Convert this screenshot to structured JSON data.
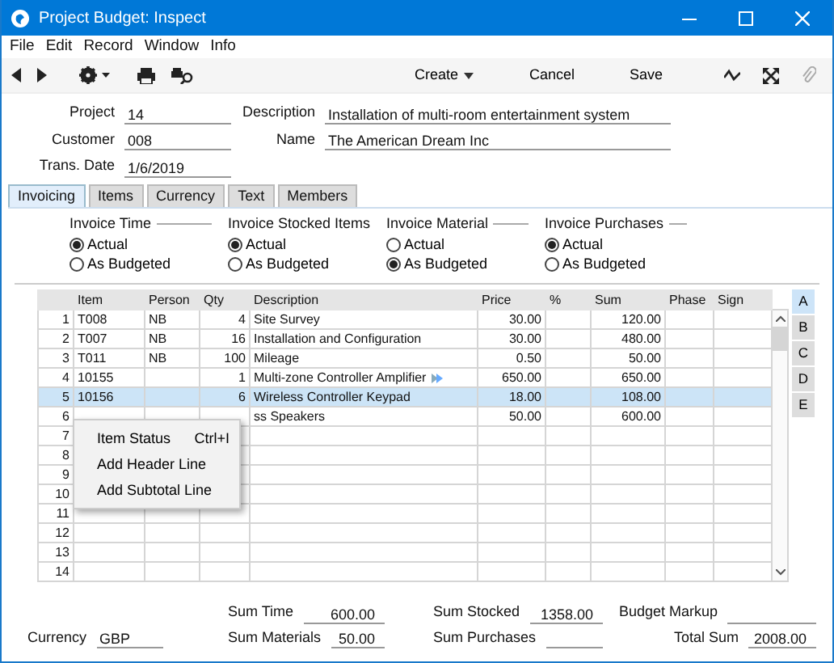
{
  "window": {
    "title": "Project Budget: Inspect"
  },
  "menu": [
    "File",
    "Edit",
    "Record",
    "Window",
    "Info"
  ],
  "toolbar": {
    "buttons": [
      {
        "label": "Create",
        "kind": "dropdown"
      },
      {
        "label": "Cancel",
        "kind": "plain"
      },
      {
        "label": "Save",
        "kind": "plain"
      }
    ]
  },
  "header_left": [
    {
      "label": "Project",
      "value": "14"
    },
    {
      "label": "Customer",
      "value": "008"
    },
    {
      "label": "Trans. Date",
      "value": "1/6/2019"
    }
  ],
  "header_right": [
    {
      "label": "Description",
      "value": "Installation of multi-room entertainment system"
    },
    {
      "label": "Name",
      "value": "The American Dream Inc"
    }
  ],
  "tabs": [
    {
      "label": "Invoicing",
      "selected": true
    },
    {
      "label": "Items",
      "selected": false
    },
    {
      "label": "Currency",
      "selected": false
    },
    {
      "label": "Text",
      "selected": false
    },
    {
      "label": "Members",
      "selected": false
    }
  ],
  "radio_groups": [
    {
      "title": "Invoice Time",
      "options": [
        {
          "label": "Actual",
          "selected": true
        },
        {
          "label": "As Budgeted",
          "selected": false
        }
      ]
    },
    {
      "title": "Invoice Stocked Items",
      "options": [
        {
          "label": "Actual",
          "selected": true
        },
        {
          "label": "As Budgeted",
          "selected": false
        }
      ]
    },
    {
      "title": "Invoice Material",
      "options": [
        {
          "label": "Actual",
          "selected": false
        },
        {
          "label": "As Budgeted",
          "selected": true
        }
      ]
    },
    {
      "title": "Invoice Purchases",
      "options": [
        {
          "label": "Actual",
          "selected": true
        },
        {
          "label": "As Budgeted",
          "selected": false
        }
      ]
    }
  ],
  "table": {
    "columns": [
      "Item",
      "Person",
      "Qty",
      "Description",
      "Price",
      "%",
      "Sum",
      "Phase",
      "Sign"
    ],
    "rows": [
      {
        "number": "1",
        "selected": false,
        "cells": [
          "T008",
          "NB",
          "4",
          "Site Survey",
          "30.00",
          "",
          "120.00",
          "",
          ""
        ]
      },
      {
        "number": "2",
        "selected": false,
        "cells": [
          "T007",
          "NB",
          "16",
          "Installation and Configuration",
          "30.00",
          "",
          "480.00",
          "",
          ""
        ]
      },
      {
        "number": "3",
        "selected": false,
        "cells": [
          "T011",
          "NB",
          "100",
          "Mileage",
          "0.50",
          "",
          "50.00",
          "",
          ""
        ]
      },
      {
        "number": "4",
        "selected": false,
        "linked": true,
        "cells": [
          "10155",
          "",
          "1",
          "Multi-zone Controller Amplifier",
          "650.00",
          "",
          "650.00",
          "",
          ""
        ]
      },
      {
        "number": "5",
        "selected": true,
        "cells": [
          "10156",
          "",
          "6",
          "Wireless Controller Keypad",
          "18.00",
          "",
          "108.00",
          "",
          ""
        ]
      },
      {
        "number": "6",
        "selected": false,
        "cells": [
          "",
          "",
          "",
          "ss Speakers",
          "50.00",
          "",
          "600.00",
          "",
          ""
        ]
      },
      {
        "number": "7",
        "selected": false,
        "cells": [
          "",
          "",
          "",
          "",
          "",
          "",
          "",
          "",
          ""
        ]
      },
      {
        "number": "8",
        "selected": false,
        "cells": [
          "",
          "",
          "",
          "",
          "",
          "",
          "",
          "",
          ""
        ]
      },
      {
        "number": "9",
        "selected": false,
        "cells": [
          "",
          "",
          "",
          "",
          "",
          "",
          "",
          "",
          ""
        ]
      },
      {
        "number": "10",
        "selected": false,
        "cells": [
          "",
          "",
          "",
          "",
          "",
          "",
          "",
          "",
          ""
        ]
      },
      {
        "number": "11",
        "selected": false,
        "cells": [
          "",
          "",
          "",
          "",
          "",
          "",
          "",
          "",
          ""
        ]
      },
      {
        "number": "12",
        "selected": false,
        "cells": [
          "",
          "",
          "",
          "",
          "",
          "",
          "",
          "",
          ""
        ]
      },
      {
        "number": "13",
        "selected": false,
        "cells": [
          "",
          "",
          "",
          "",
          "",
          "",
          "",
          "",
          ""
        ]
      },
      {
        "number": "14",
        "selected": false,
        "cells": [
          "",
          "",
          "",
          "",
          "",
          "",
          "",
          "",
          ""
        ]
      }
    ]
  },
  "side_tabs": [
    {
      "label": "A",
      "selected": true
    },
    {
      "label": "B",
      "selected": false
    },
    {
      "label": "C",
      "selected": false
    },
    {
      "label": "D",
      "selected": false
    },
    {
      "label": "E",
      "selected": false
    }
  ],
  "context_menu": [
    {
      "label": "Item Status",
      "shortcut": "Ctrl+I"
    },
    {
      "label": "Add Header Line"
    },
    {
      "label": "Add Subtotal Line"
    }
  ],
  "footer": [
    [
      {
        "kind": "blank"
      },
      {
        "kind": "field",
        "label": "Sum Time",
        "value": "600.00"
      },
      {
        "kind": "field",
        "label": "Sum Stocked",
        "value": "1358.00"
      },
      {
        "kind": "field",
        "label": "Budget Markup"
      }
    ],
    [
      {
        "kind": "field",
        "label": "Currency",
        "value": "GBP"
      },
      {
        "kind": "field",
        "label": "Sum Materials",
        "value": "50.00"
      },
      {
        "kind": "field",
        "label": "Sum Purchases"
      },
      {
        "kind": "field",
        "label": "Total Sum",
        "value": "2008.00"
      }
    ]
  ]
}
